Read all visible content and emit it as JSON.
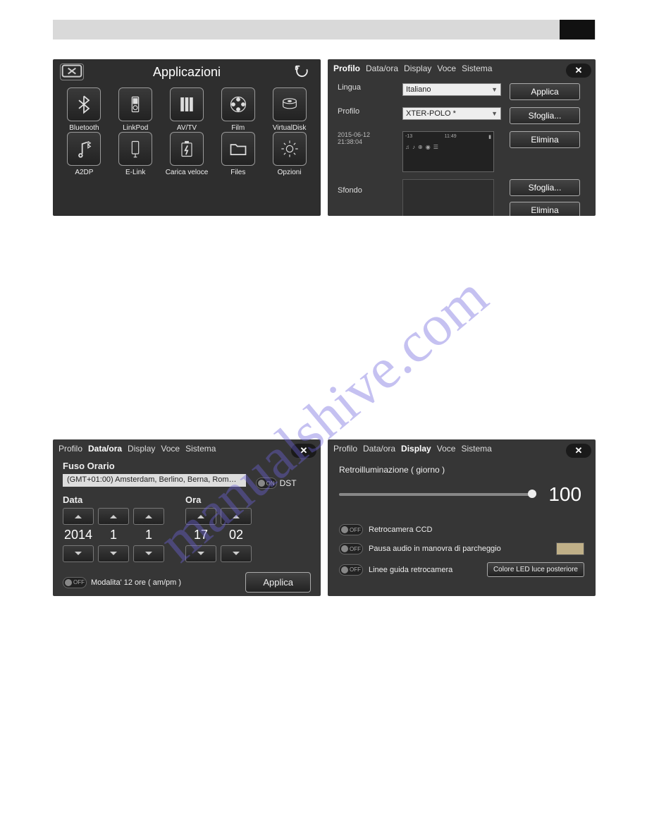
{
  "watermark": "manualshive.com",
  "screen1": {
    "title": "Applicazioni",
    "apps": [
      {
        "label": "Bluetooth",
        "icon": "bluetooth"
      },
      {
        "label": "LinkPod",
        "icon": "ipod"
      },
      {
        "label": "AV/TV",
        "icon": "av"
      },
      {
        "label": "Film",
        "icon": "film"
      },
      {
        "label": "VirtualDisk",
        "icon": "disk"
      },
      {
        "label": "A2DP",
        "icon": "a2dp"
      },
      {
        "label": "E-Link",
        "icon": "elink"
      },
      {
        "label": "Carica veloce",
        "icon": "charge"
      },
      {
        "label": "Files",
        "icon": "files"
      },
      {
        "label": "Opzioni",
        "icon": "gear"
      }
    ]
  },
  "tabs": {
    "t1": "Profilo",
    "t2": "Data/ora",
    "t3": "Display",
    "t4": "Voce",
    "t5": "Sistema"
  },
  "screen2": {
    "lingua_label": "Lingua",
    "lingua_value": "Italiano",
    "profilo_label": "Profilo",
    "profilo_value": "XTER-POLO *",
    "timestamp": "2015-06-12\n21:38:04",
    "sfondo_label": "Sfondo",
    "btn_applica": "Applica",
    "btn_sfoglia": "Sfoglia...",
    "btn_elimina": "Elimina",
    "thumb_time": "11:49"
  },
  "screen3": {
    "fuso_label": "Fuso Orario",
    "tz_value": "(GMT+01:00) Amsterdam, Berlino, Berna, Rom…",
    "dst_label": "DST",
    "data_label": "Data",
    "ora_label": "Ora",
    "year": "2014",
    "month": "1",
    "day": "1",
    "hour": "17",
    "minute": "02",
    "mode12_label": "Modalita' 12 ore ( am/pm )",
    "applica": "Applica",
    "off": "OFF"
  },
  "screen4": {
    "backlight_label": "Retroilluminazione ( giorno )",
    "backlight_value": "100",
    "opt1": "Retrocamera CCD",
    "opt2": "Pausa audio in manovra di parcheggio",
    "opt3": "Linee guida retrocamera",
    "led_btn": "Colore LED luce posteriore",
    "off": "OFF"
  }
}
